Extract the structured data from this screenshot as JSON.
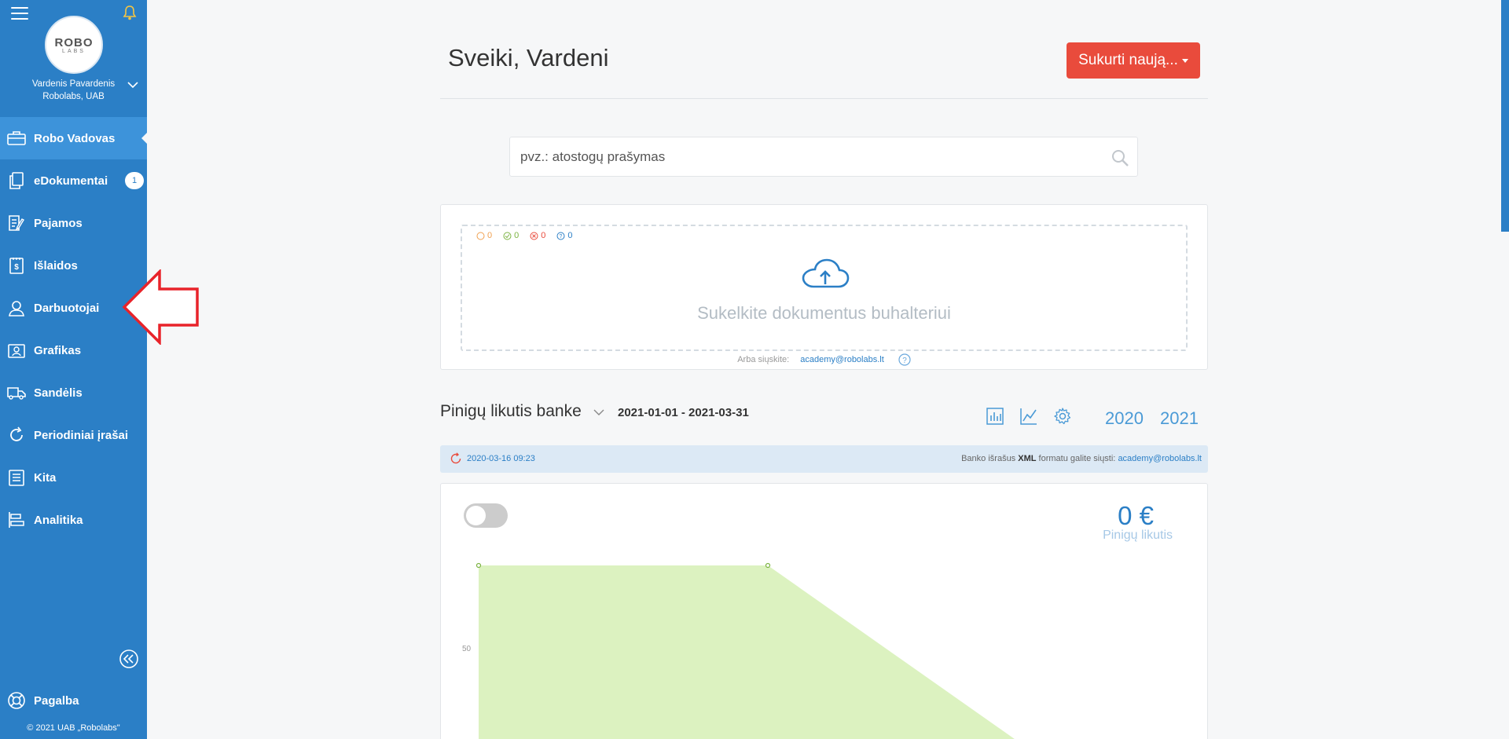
{
  "user": {
    "name": "Vardenis Pavardenis",
    "company": "Robolabs, UAB"
  },
  "logo": {
    "line1": "ROBO",
    "line2": "LABS"
  },
  "nav": {
    "items": [
      {
        "label": "Robo Vadovas",
        "icon": "briefcase-icon",
        "active": true
      },
      {
        "label": "eDokumentai",
        "icon": "documents-icon",
        "badge": "1"
      },
      {
        "label": "Pajamos",
        "icon": "edit-document-icon"
      },
      {
        "label": "Išlaidos",
        "icon": "receipt-icon"
      },
      {
        "label": "Darbuotojai",
        "icon": "employee-icon"
      },
      {
        "label": "Grafikas",
        "icon": "schedule-icon"
      },
      {
        "label": "Sandėlis",
        "icon": "truck-icon"
      },
      {
        "label": "Periodiniai įrašai",
        "icon": "refresh-icon"
      },
      {
        "label": "Kita",
        "icon": "list-icon"
      },
      {
        "label": "Analitika",
        "icon": "bar-chart-icon"
      }
    ],
    "help_label": "Pagalba",
    "copyright": "© 2021 UAB „Robolabs\""
  },
  "header": {
    "greeting": "Sveiki, Vardeni",
    "create_label": "Sukurti naują..."
  },
  "search": {
    "placeholder": "pvz.: atostogų prašymas"
  },
  "upload": {
    "counters": [
      {
        "icon": "pending-icon",
        "value": "0",
        "color": "#f0a050"
      },
      {
        "icon": "check-icon",
        "value": "0",
        "color": "#7cb342"
      },
      {
        "icon": "error-icon",
        "value": "0",
        "color": "#e94b3c"
      },
      {
        "icon": "question-icon",
        "value": "0",
        "color": "#2b7fc6"
      }
    ],
    "drop_text": "Sukelkite dokumentus buhalteriui",
    "email_prefix": "Arba siųskite:",
    "email": "academy@robolabs.lt"
  },
  "balance": {
    "title": "Pinigų likutis banke",
    "date_range": "2021-01-01 - 2021-03-31",
    "years": [
      "2020",
      "2021"
    ],
    "timestamp": "2020-03-16 09:23",
    "note_prefix": "Banko išrašus",
    "note_format": "XML",
    "note_suffix": "formatu galite siųsti:",
    "note_email": "academy@robolabs.lt",
    "value": "0 €",
    "value_label": "Pinigų likutis"
  },
  "chart_data": {
    "type": "area",
    "y_tick_labels": [
      "50"
    ],
    "fill_color": "#dcf2c0",
    "point_color": "#7cb342"
  },
  "colors": {
    "sidebar": "#2b7fc6",
    "accent_red": "#e94b3c",
    "link_blue": "#2b7fc6"
  }
}
